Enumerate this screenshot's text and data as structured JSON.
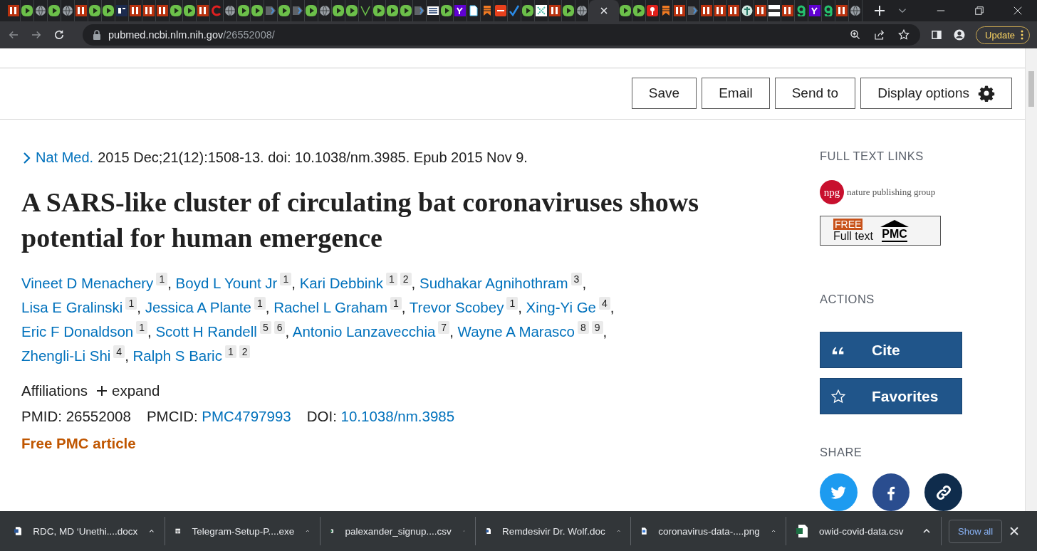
{
  "browser": {
    "tabs": [
      {
        "kind": "bi",
        "selected": false
      },
      {
        "kind": "play",
        "selected": false
      },
      {
        "kind": "globe",
        "selected": false
      },
      {
        "kind": "play",
        "selected": false
      },
      {
        "kind": "globe",
        "selected": false
      },
      {
        "kind": "bi",
        "selected": false
      },
      {
        "kind": "play",
        "selected": false
      },
      {
        "kind": "play",
        "selected": false
      },
      {
        "kind": "et",
        "selected": false
      },
      {
        "kind": "bi",
        "selected": false
      },
      {
        "kind": "bi",
        "selected": false
      },
      {
        "kind": "bi",
        "selected": false
      },
      {
        "kind": "play",
        "selected": false
      },
      {
        "kind": "play",
        "selected": false
      },
      {
        "kind": "bi",
        "selected": false
      },
      {
        "kind": "ring",
        "selected": false
      },
      {
        "kind": "globe",
        "selected": false
      },
      {
        "kind": "play",
        "selected": false
      },
      {
        "kind": "play",
        "selected": false
      },
      {
        "kind": "arrow",
        "selected": false
      },
      {
        "kind": "play",
        "selected": false
      },
      {
        "kind": "arrow",
        "selected": false
      },
      {
        "kind": "play",
        "selected": false
      },
      {
        "kind": "globe",
        "selected": false
      },
      {
        "kind": "play",
        "selected": false
      },
      {
        "kind": "play",
        "selected": false
      },
      {
        "kind": "vee",
        "selected": false
      },
      {
        "kind": "play",
        "selected": false
      },
      {
        "kind": "play",
        "selected": false
      },
      {
        "kind": "play",
        "selected": false
      },
      {
        "kind": "arrow",
        "selected": false
      },
      {
        "kind": "news",
        "selected": false
      },
      {
        "kind": "play",
        "selected": false
      },
      {
        "kind": "yahoo",
        "selected": false
      },
      {
        "kind": "doc",
        "selected": false
      },
      {
        "kind": "bookmark",
        "selected": false
      },
      {
        "kind": "redbox",
        "selected": false
      },
      {
        "kind": "check",
        "selected": false
      },
      {
        "kind": "play",
        "selected": false
      },
      {
        "kind": "grid",
        "selected": false
      },
      {
        "kind": "bi",
        "selected": false
      },
      {
        "kind": "play",
        "selected": false
      },
      {
        "kind": "globe",
        "selected": false
      },
      {
        "kind": "none",
        "selected": true
      },
      {
        "kind": "play",
        "selected": false
      },
      {
        "kind": "play",
        "selected": false
      },
      {
        "kind": "pin",
        "selected": false
      },
      {
        "kind": "bookmark",
        "selected": false
      },
      {
        "kind": "bi",
        "selected": false
      },
      {
        "kind": "arrow",
        "selected": false
      },
      {
        "kind": "bi",
        "selected": false
      },
      {
        "kind": "bi",
        "selected": false
      },
      {
        "kind": "bi",
        "selected": false
      },
      {
        "kind": "tree",
        "selected": false
      },
      {
        "kind": "bi",
        "selected": false
      },
      {
        "kind": "bar",
        "selected": false
      },
      {
        "kind": "bi",
        "selected": false
      },
      {
        "kind": "g",
        "selected": false
      },
      {
        "kind": "yahoo",
        "selected": false
      },
      {
        "kind": "g",
        "selected": false
      },
      {
        "kind": "bi",
        "selected": false
      },
      {
        "kind": "globe",
        "selected": false
      }
    ],
    "address": {
      "host": "pubmed.ncbi.nlm.nih.gov",
      "path": "/26552008/"
    },
    "update_button": "Update"
  },
  "header_buttons": [
    {
      "label": "Save",
      "kind": "plain"
    },
    {
      "label": "Email",
      "kind": "plain"
    },
    {
      "label": "Send to",
      "kind": "plain"
    },
    {
      "label": "Display options",
      "kind": "gear"
    }
  ],
  "citation": {
    "journal": "Nat Med.",
    "details": "2015 Dec;21(12):1508-13. doi: 10.1038/nm.3985. Epub 2015 Nov 9."
  },
  "title": "A SARS-like cluster of circulating bat coronaviruses shows potential for human emergence",
  "authors": [
    {
      "name": "Vineet D Menachery",
      "affiliations": [
        "1"
      ],
      "separator": ","
    },
    {
      "name": "Boyd L Yount Jr",
      "affiliations": [
        "1"
      ],
      "separator": ","
    },
    {
      "name": "Kari Debbink",
      "affiliations": [
        "1",
        "2"
      ],
      "separator": ","
    },
    {
      "name": "Sudhakar Agnihothram",
      "affiliations": [
        "3"
      ],
      "separator": ","
    },
    {
      "name": "Lisa E Gralinski",
      "affiliations": [
        "1"
      ],
      "separator": ","
    },
    {
      "name": "Jessica A Plante",
      "affiliations": [
        "1"
      ],
      "separator": ","
    },
    {
      "name": "Rachel L Graham",
      "affiliations": [
        "1"
      ],
      "separator": ","
    },
    {
      "name": "Trevor Scobey",
      "affiliations": [
        "1"
      ],
      "separator": ","
    },
    {
      "name": "Xing-Yi Ge",
      "affiliations": [
        "4"
      ],
      "separator": ","
    },
    {
      "name": "Eric F Donaldson",
      "affiliations": [
        "1"
      ],
      "separator": ","
    },
    {
      "name": "Scott H Randell",
      "affiliations": [
        "5",
        "6"
      ],
      "separator": ","
    },
    {
      "name": "Antonio Lanzavecchia",
      "affiliations": [
        "7"
      ],
      "separator": ","
    },
    {
      "name": "Wayne A Marasco",
      "affiliations": [
        "8",
        "9"
      ],
      "separator": ","
    },
    {
      "name": "Zhengli-Li Shi",
      "affiliations": [
        "4"
      ],
      "separator": ","
    },
    {
      "name": "Ralph S Baric",
      "affiliations": [
        "1",
        "2"
      ]
    }
  ],
  "affiliations": {
    "label": "Affiliations",
    "toggle": "expand"
  },
  "identifiers": [
    {
      "label": "PMID:",
      "value": "26552008",
      "link": false
    },
    {
      "label": "PMCID:",
      "value": "PMC4797993",
      "link": true
    },
    {
      "label": "DOI:",
      "value": "10.1038/nm.3985",
      "link": true
    }
  ],
  "free_article": "Free PMC article",
  "sidebar": {
    "full_text_heading": "FULL TEXT LINKS",
    "full_text_links": [
      {
        "kind": "publisher",
        "logo": "npg",
        "text": "nature publishing group"
      },
      {
        "kind": "pmc",
        "badge": "FREE",
        "text": "Full text",
        "logo": "PMC"
      }
    ],
    "actions_heading": "ACTIONS",
    "actions": [
      {
        "label": "Cite",
        "kind": "cite"
      },
      {
        "label": "Favorites",
        "kind": "favorite"
      }
    ],
    "share_heading": "SHARE",
    "share": [
      {
        "kind": "twitter"
      },
      {
        "kind": "facebook"
      },
      {
        "kind": "link"
      }
    ]
  },
  "downloads": {
    "items": [
      {
        "name": "RDC, MD ‘Unethi....docx",
        "kind": "word"
      },
      {
        "name": "Telegram-Setup-P....exe",
        "kind": "exe"
      },
      {
        "name": "palexander_signup....csv",
        "kind": "excel"
      },
      {
        "name": "Remdesivir Dr. Wolf.doc",
        "kind": "word"
      },
      {
        "name": "coronavirus-data-....png",
        "kind": "image"
      },
      {
        "name": "owid-covid-data.csv",
        "kind": "excel"
      }
    ],
    "show_all": "Show all"
  }
}
